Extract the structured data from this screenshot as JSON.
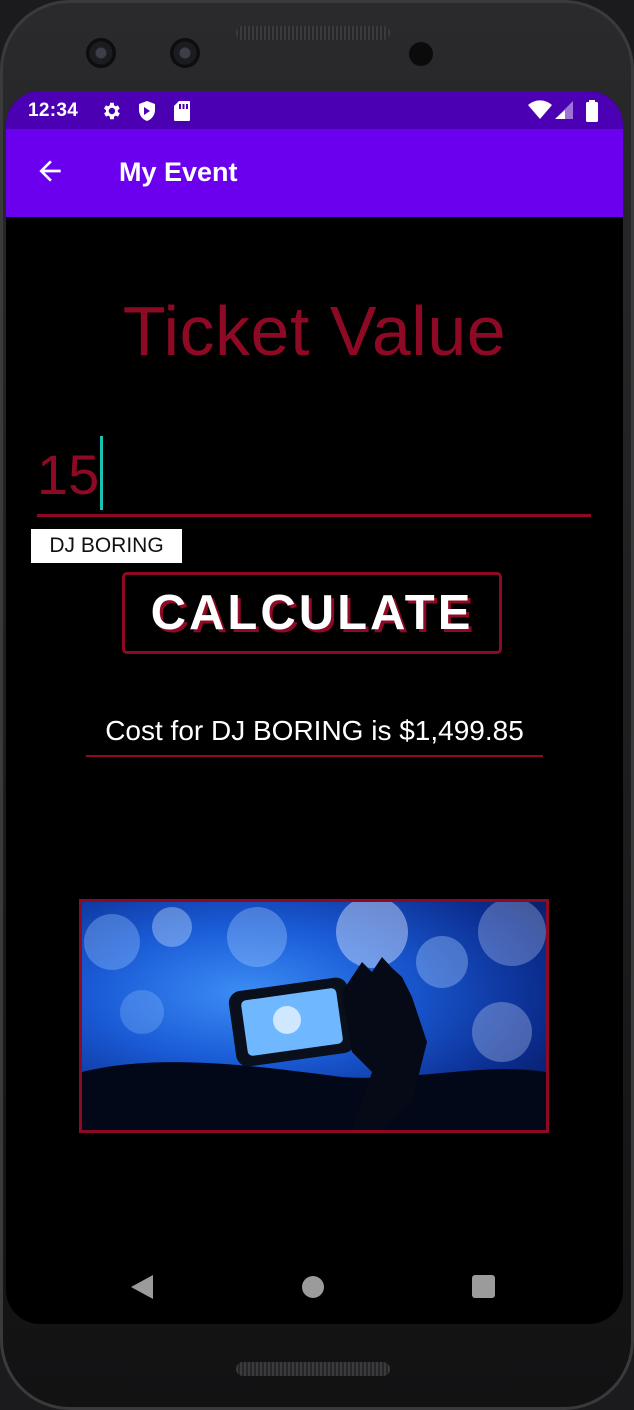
{
  "status_bar": {
    "time": "12:34",
    "icons": [
      "gear-icon",
      "shield-icon",
      "sd-card-icon",
      "wifi-icon",
      "signal-icon",
      "battery-icon"
    ]
  },
  "app_bar": {
    "title": "My Event",
    "back_icon": "arrow-back-icon",
    "color": "#6a00ee"
  },
  "main": {
    "heading": "Ticket Value",
    "ticket_input": {
      "value": "15"
    },
    "dj_chip": "DJ BORING",
    "calculate_button": "CALCULATE",
    "result_text": "Cost for DJ BORING is $1,499.85"
  },
  "nav_bar": {
    "icons": [
      "back-triangle-icon",
      "home-circle-icon",
      "recents-square-icon"
    ]
  },
  "colors": {
    "accent": "#8e0a24",
    "status_bar": "#4c00b4",
    "caret": "#19c2b2",
    "background": "#000000"
  }
}
